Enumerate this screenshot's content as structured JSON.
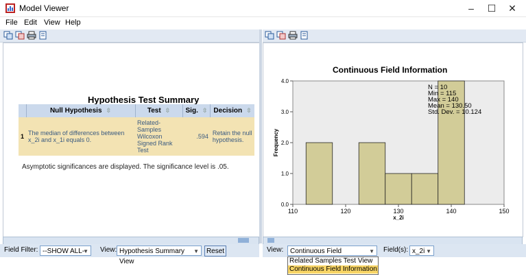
{
  "window": {
    "title": "Model Viewer",
    "minimize": "–",
    "maximize": "☐",
    "close": "✕"
  },
  "menu": {
    "items": [
      "File",
      "Edit",
      "View",
      "Help"
    ]
  },
  "left_pane": {
    "table_title": "Hypothesis Test Summary",
    "columns": [
      "Null Hypothesis",
      "Test",
      "Sig.",
      "Decision"
    ],
    "rows": [
      {
        "index": "1",
        "null_hypothesis": "The median of differences between x_2i and x_1i equals 0.",
        "test": "Related-Samples Wilcoxon Signed Rank Test",
        "sig": ".594",
        "decision": "Retain the null hypothesis."
      }
    ],
    "note": "Asymptotic significances are displayed.  The significance level is .05."
  },
  "left_footer": {
    "field_filter_label": "Field Filter:",
    "field_filter_value": "--SHOW ALL--",
    "view_label": "View:",
    "view_value": "Hypothesis Summary View",
    "reset_label": "Reset"
  },
  "right_footer": {
    "view_label": "View:",
    "view_value": "Continuous Field Information",
    "fields_label": "Field(s):",
    "fields_value": "x_2i",
    "dropdown_options": [
      "Related Samples Test View",
      "Continuous Field Information"
    ],
    "selected_option": "Continuous Field Information"
  },
  "colors": {
    "table_row": "#f3e3b3",
    "table_header": "#cbd9ec",
    "bar": "#d2cc98",
    "plot_bg": "#ececec",
    "selected_option": "#f8d566"
  },
  "chart_data": {
    "type": "bar",
    "title": "Continuous Field Information",
    "xlabel": "x_2i",
    "ylabel": "Frequency",
    "xlim": [
      110,
      150
    ],
    "ylim": [
      0,
      4
    ],
    "x_ticks": [
      "110",
      "120",
      "130",
      "140",
      "150"
    ],
    "y_ticks": [
      "0.0",
      "1.0",
      "2.0",
      "3.0",
      "4.0"
    ],
    "bins": [
      {
        "start": 112.5,
        "end": 117.5,
        "value": 2
      },
      {
        "start": 117.5,
        "end": 122.5,
        "value": 0
      },
      {
        "start": 122.5,
        "end": 127.5,
        "value": 2
      },
      {
        "start": 127.5,
        "end": 132.5,
        "value": 1
      },
      {
        "start": 132.5,
        "end": 137.5,
        "value": 1
      },
      {
        "start": 137.5,
        "end": 142.5,
        "value": 4
      }
    ],
    "stats": [
      "N = 10",
      "Min = 115",
      "Max = 140",
      "Mean = 130.50",
      "Std. Dev. = 10.124"
    ],
    "grid": false
  }
}
